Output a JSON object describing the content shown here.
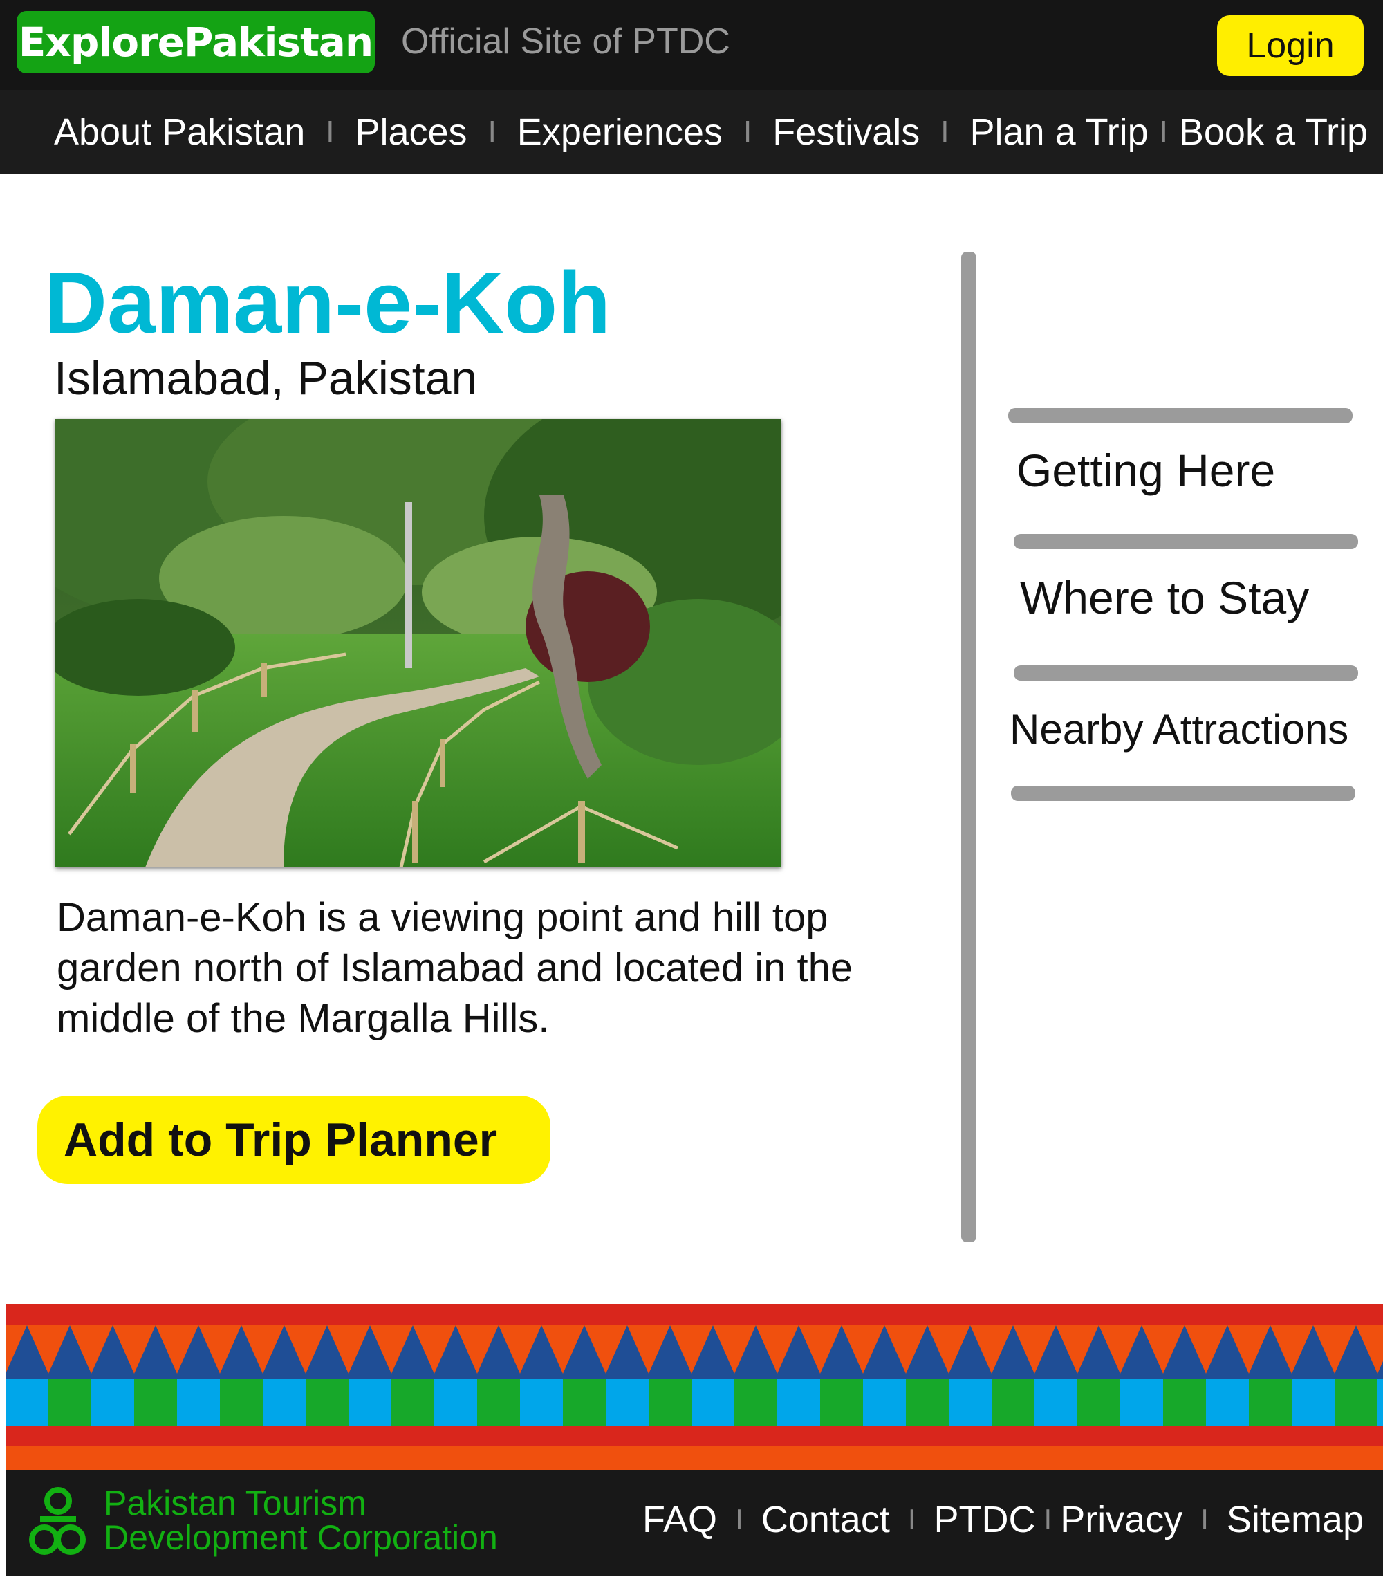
{
  "header": {
    "logo_text": "ExplorePakistan",
    "tagline": "Official Site of PTDC",
    "login_label": "Login"
  },
  "nav": {
    "items": [
      {
        "label": "About Pakistan"
      },
      {
        "label": "Places"
      },
      {
        "label": "Experiences"
      },
      {
        "label": "Festivals"
      },
      {
        "label": "Plan a Trip"
      },
      {
        "label": "Book a Trip"
      }
    ],
    "separator": "I"
  },
  "main": {
    "title": "Daman-e-Koh",
    "subtitle": "Islamabad, Pakistan",
    "description": "Daman-e-Koh is a viewing point and hill top garden north of Islamabad and located in the middle of the Margalla Hills.",
    "cta_label": "Add to Trip Planner"
  },
  "sidebar": {
    "links": [
      {
        "label": "Getting Here"
      },
      {
        "label": "Where to Stay"
      },
      {
        "label": "Nearby Attractions"
      }
    ]
  },
  "footer": {
    "org_line1": "Pakistan Tourism",
    "org_line2": "Development Corporation",
    "links": [
      {
        "label": "FAQ"
      },
      {
        "label": "Contact"
      },
      {
        "label": "PTDC"
      },
      {
        "label": "Privacy"
      },
      {
        "label": "Sitemap"
      }
    ]
  },
  "colors": {
    "brand_green": "#14a314",
    "accent_yellow": "#ffee00",
    "title_cyan": "#00b8d4",
    "pattern_red": "#d9261c",
    "pattern_orange": "#f0500e",
    "pattern_navy": "#1f4e96",
    "pattern_green": "#17a82a",
    "pattern_sky": "#00a6ea"
  }
}
